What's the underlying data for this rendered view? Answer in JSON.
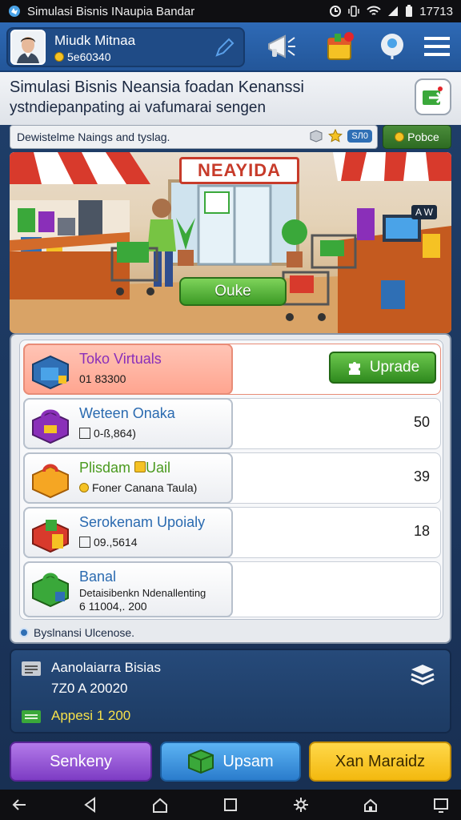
{
  "status_bar": {
    "app_title": "Simulasi Bisnis INaupia Bandar",
    "time": "17713"
  },
  "profile": {
    "name": "Miudk Mitnaa",
    "coins": "5e60340"
  },
  "page": {
    "title": "Simulasi Bisnis Neansia foadan Kenanssi",
    "subtitle": "ystndiepanpating ai vafumarai sengen"
  },
  "info_strip": {
    "text": "Dewistelme Naings and tyslag.",
    "badge": "SЛ0",
    "side_button": "Pobce"
  },
  "scene": {
    "store_sign": "NEAYIDA",
    "ok_button": "Ouke",
    "tag": "A W"
  },
  "businesses": [
    {
      "name": "Toko Virtuals",
      "sub": "01 83300",
      "action": "Uprade",
      "color": "#8a2fb9"
    },
    {
      "name": "Weteen Onaka",
      "sub": "0-ß,864)",
      "value": "50",
      "color": "#2a6ab0"
    },
    {
      "name": "Plisdam",
      "name_extra": "Uail",
      "sub": "Foner Canana Taula)",
      "value": "39",
      "color": "#4a9a1e"
    },
    {
      "name": "Serokenam Upoialy",
      "sub": "09.,5614",
      "value": "18",
      "color": "#2a6ab0"
    },
    {
      "name": "Banal",
      "sub": "Detaisibenkn Ndenallenting",
      "sub2": "6 11004,. 200",
      "color": "#2a6ab0"
    }
  ],
  "list_footer": "Byslnansi Ulcenose.",
  "summary": {
    "line1": "Aanolaiarra Bisias",
    "line2": "7Z0 A 20020",
    "line3": "Appesi 1 200"
  },
  "bottom_buttons": {
    "left": "Senkeny",
    "middle": "Upsam",
    "right": "Xan Maraidz"
  }
}
